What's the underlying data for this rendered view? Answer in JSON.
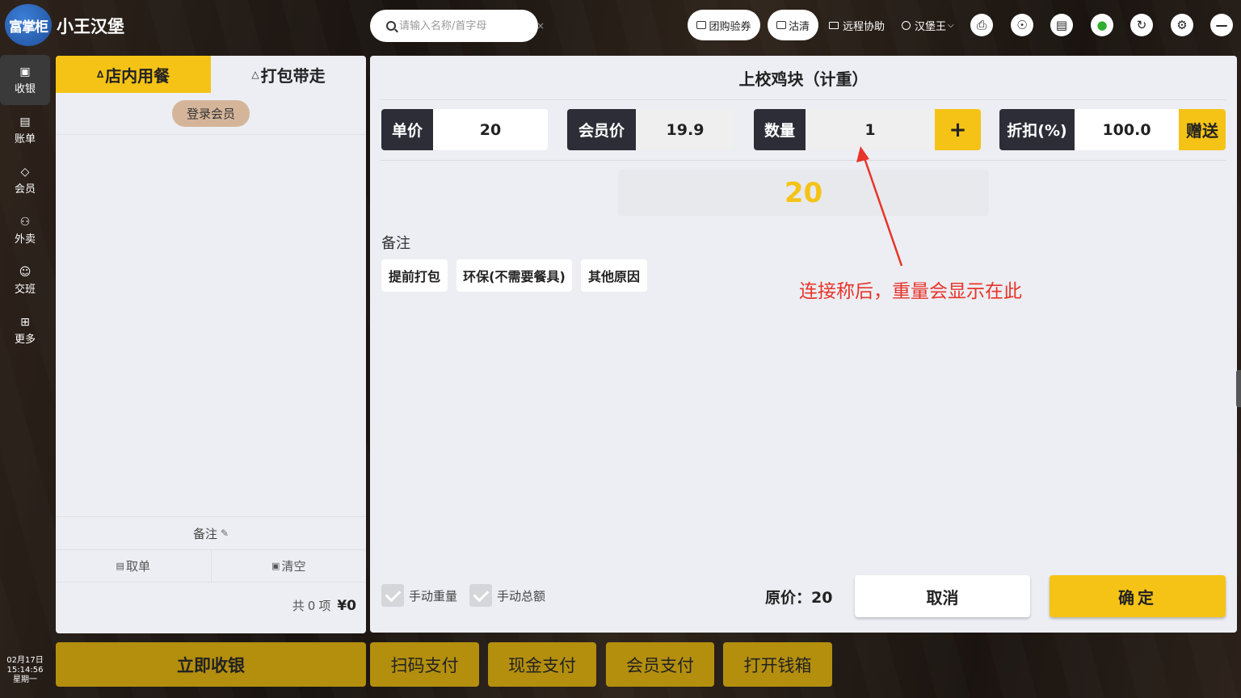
{
  "header": {
    "logo_text": "富掌柜",
    "shop_name": "小王汉堡",
    "search_placeholder": "请输入名称/首字母",
    "search_clear": "×",
    "group_coupon": "团购验券",
    "clean": "沽清",
    "remote_help": "远程协助",
    "user": "汉堡王",
    "icons": [
      "printer-icon",
      "support-icon",
      "screen-icon",
      "wifi-icon",
      "refresh-icon",
      "settings-icon",
      "minimize-icon"
    ]
  },
  "sidebar": {
    "items": [
      {
        "label": "收银",
        "icon": "cashier-icon",
        "active": true
      },
      {
        "label": "账单",
        "icon": "bill-icon"
      },
      {
        "label": "会员",
        "icon": "diamond-icon"
      },
      {
        "label": "外卖",
        "icon": "delivery-icon"
      },
      {
        "label": "交班",
        "icon": "handover-icon"
      },
      {
        "label": "更多",
        "icon": "grid-icon"
      }
    ],
    "date": "02月17日",
    "time": "15:14:56",
    "weekday": "星期一"
  },
  "order": {
    "tabs": [
      "店内用餐",
      "打包带走"
    ],
    "member_login": "登录会员",
    "remark": "备注",
    "take_order": "取单",
    "clear": "清空",
    "count_prefix": "共",
    "count": "0",
    "count_suffix": "项",
    "total": "¥0"
  },
  "dialog": {
    "title": "上校鸡块（计重）",
    "unit_price_label": "单价",
    "unit_price": "20",
    "member_price_label": "会员价",
    "member_price": "19.9",
    "quantity_label": "数量",
    "quantity": "1",
    "plus": "+",
    "discount_label": "折扣(%)",
    "discount": "100.0",
    "gift": "赠送",
    "subtotal": "20",
    "remark_label": "备注",
    "remark_options": [
      "提前打包",
      "环保(不需要餐具)",
      "其他原因"
    ],
    "annotation": "连接称后，重量会显示在此",
    "manual_weight": "手动重量",
    "manual_total": "手动总额",
    "original_price": "原价：20",
    "cancel": "取消",
    "confirm": "确定"
  },
  "bottom": {
    "checkout": "立即收银",
    "scan_pay": "扫码支付",
    "cash_pay": "现金支付",
    "member_pay": "会员支付",
    "open_drawer": "打开钱箱"
  },
  "colors": {
    "accent": "#f5c316",
    "dark_label": "#2d2d38",
    "annotation": "#e8342a",
    "bottom_button": "#b48f0e"
  }
}
